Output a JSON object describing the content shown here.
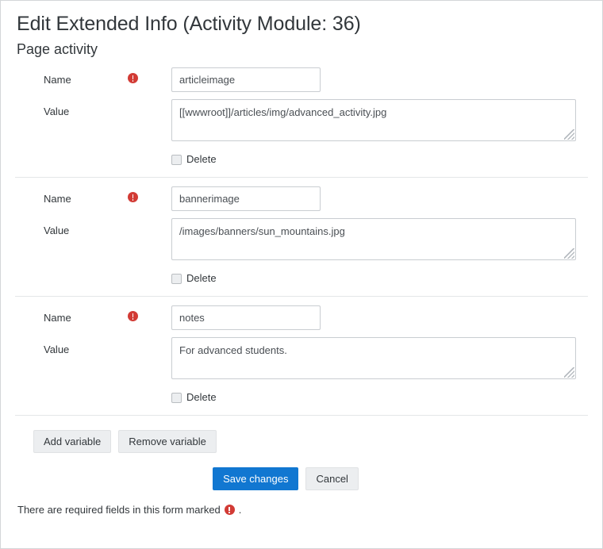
{
  "page": {
    "title": "Edit Extended Info (Activity Module: 36)",
    "section_title": "Page activity"
  },
  "labels": {
    "name": "Name",
    "value": "Value",
    "delete": "Delete",
    "required_icon": "required-exclamation-icon"
  },
  "variables": [
    {
      "name": "articleimage",
      "value": "[[wwwroot]]/articles/img/advanced_activity.jpg",
      "delete_checked": false
    },
    {
      "name": "bannerimage",
      "value": "/images/banners/sun_mountains.jpg",
      "delete_checked": false
    },
    {
      "name": "notes",
      "value": "For advanced students.",
      "delete_checked": false
    }
  ],
  "buttons": {
    "add_variable": "Add variable",
    "remove_variable": "Remove variable",
    "save_changes": "Save changes",
    "cancel": "Cancel"
  },
  "footer": {
    "note_before": "There are required fields in this form marked",
    "note_after": "."
  },
  "colors": {
    "primary": "#1177d1",
    "required": "#d23b35",
    "border": "#c9cdd1",
    "divider": "#e4e6e8",
    "button_default_bg": "#eceef0"
  }
}
